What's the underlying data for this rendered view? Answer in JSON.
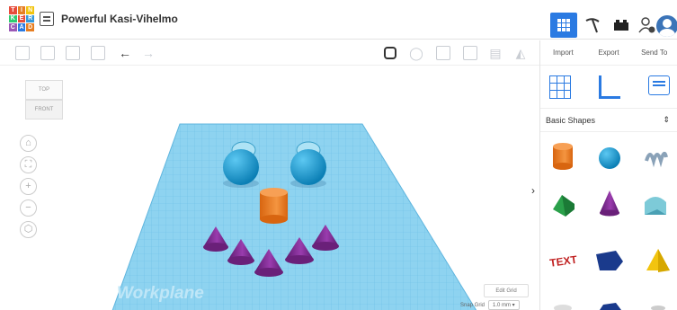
{
  "logo": {
    "letters": [
      "T",
      "I",
      "N",
      "K",
      "E",
      "R",
      "C",
      "A",
      "D"
    ],
    "colors": [
      "#e74c3c",
      "#e67e22",
      "#f1c40f",
      "#2ecc71",
      "#e74c3c",
      "#3498db",
      "#9b59b6",
      "#2a7ae2",
      "#e67e22"
    ]
  },
  "header": {
    "design_title": "Powerful Kasi-Vihelmo"
  },
  "panel": {
    "tabs": [
      "Import",
      "Export",
      "Send To"
    ],
    "library_label": "Basic Shapes",
    "library_chevron": "⌃⌄"
  },
  "viewcube": {
    "top": "TOP",
    "front": "FRONT"
  },
  "workplane": {
    "label": "Workplane"
  },
  "grid": {
    "edit_label": "Edit Grid",
    "snap_label": "Snap Grid",
    "snap_value": "1.0 mm ▾"
  },
  "colors": {
    "accent": "#2a7ae2",
    "workplane": "#8ed3f0",
    "orange": "#f07c1b",
    "sphere": "#1da0d8",
    "cone": "#7b2a8c"
  },
  "icons": {
    "toolbar": [
      "copy-icon",
      "paste-icon",
      "duplicate-icon",
      "delete-icon",
      "undo-icon",
      "redo-icon",
      "note-icon",
      "light-icon",
      "shape-outline-icon",
      "shape-solid-icon",
      "align-icon",
      "mirror-icon"
    ],
    "nav": [
      "home-icon",
      "fit-view-icon",
      "zoom-in-icon",
      "zoom-out-icon",
      "perspective-icon"
    ]
  }
}
